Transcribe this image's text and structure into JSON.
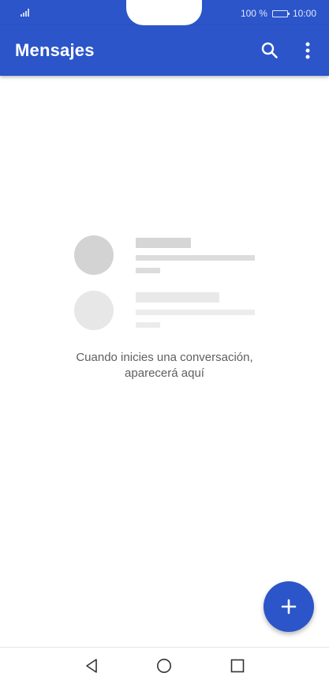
{
  "status_bar": {
    "battery_text": "100 %",
    "time": "10:00",
    "icons": [
      "signal-icon",
      "battery-icon"
    ]
  },
  "app_bar": {
    "title": "Mensajes",
    "icons": [
      "search-icon",
      "more-vert-icon"
    ]
  },
  "empty_state": {
    "message_line1": "Cuando inicies una conversación,",
    "message_line2": "aparecerá aquí"
  },
  "fab": {
    "icon": "plus-icon"
  },
  "nav_bar": {
    "icons": [
      "back-icon",
      "home-icon",
      "recents-icon"
    ]
  },
  "colors": {
    "primary": "#2b55c9",
    "background": "#ffffff",
    "text_secondary": "#5f5f5f"
  }
}
